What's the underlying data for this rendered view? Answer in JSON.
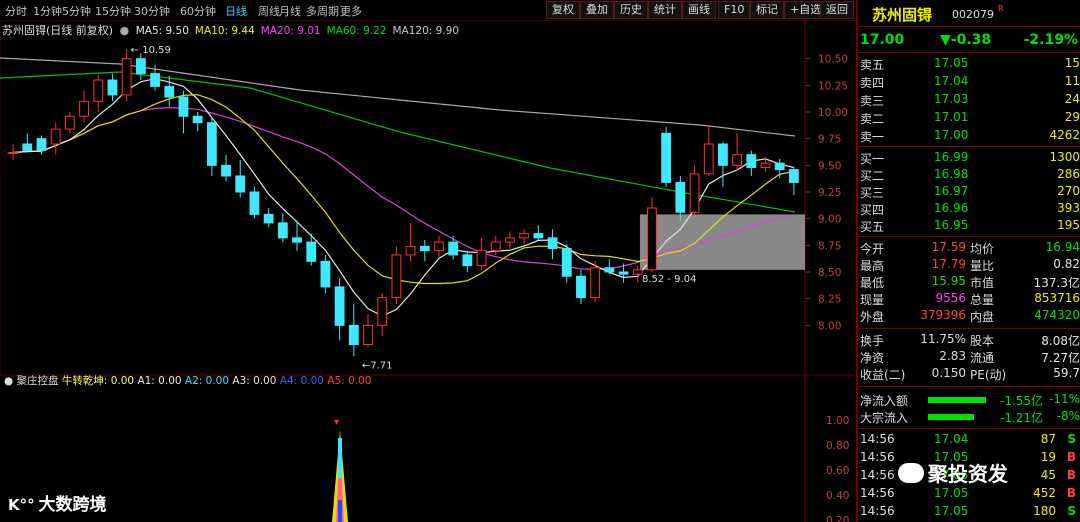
{
  "toolbar": {
    "periods": [
      "分时",
      "1分钟",
      "5分钟",
      "15分钟",
      "30分钟",
      "60分钟",
      "日线",
      "周线",
      "月线",
      "多周期",
      "更多"
    ],
    "active_period": "日线",
    "right_buttons": [
      "复权",
      "叠加",
      "历史",
      "统计",
      "画线",
      "F10",
      "标记",
      "+自选",
      "返回"
    ]
  },
  "chart_header": {
    "stock_label": "苏州固锝(日线 前复权)",
    "ma_items": [
      {
        "label": "MA5: 9.50",
        "color": "#e6e6e6"
      },
      {
        "label": "MA10: 9.44",
        "color": "#f0f000"
      },
      {
        "label": "MA20: 9.01",
        "color": "#ff40ff"
      },
      {
        "label": "MA60: 9.22",
        "color": "#00e000"
      },
      {
        "label": "MA120: 9.90",
        "color": "#c8c8c8"
      }
    ]
  },
  "price_axis": [
    "10.50",
    "10.25",
    "10.00",
    "9.75",
    "9.50",
    "9.25",
    "9.00",
    "8.75",
    "8.50",
    "8.25",
    "8.00"
  ],
  "annotations": {
    "high": "10.59",
    "low": "7.71",
    "box": "8.52 - 9.04"
  },
  "indicator": {
    "name": "聚庄控盘",
    "params": [
      {
        "label": "牛转乾坤: 0.00",
        "color": "#ffff60"
      },
      {
        "label": "A1: 0.00",
        "color": "#e6e6e6"
      },
      {
        "label": "A2: 0.00",
        "color": "#40e0ff"
      },
      {
        "label": "A3: 0.00",
        "color": "#e6e6e6"
      },
      {
        "label": "A4: 0.00",
        "color": "#4060ff"
      },
      {
        "label": "A5: 0.00",
        "color": "#ff4040"
      }
    ],
    "axis": [
      "1.00",
      "0.80",
      "0.60",
      "0.40",
      "0.20"
    ]
  },
  "panel": {
    "name": "苏州固锝",
    "code": "002079",
    "price": "17.00",
    "change": "▼-0.38",
    "pct": "-2.19%",
    "asks": [
      {
        "label": "卖五",
        "price": "17.05",
        "vol": "15"
      },
      {
        "label": "卖四",
        "price": "17.04",
        "vol": "11"
      },
      {
        "label": "卖三",
        "price": "17.03",
        "vol": "24"
      },
      {
        "label": "卖二",
        "price": "17.01",
        "vol": "29"
      },
      {
        "label": "卖一",
        "price": "17.00",
        "vol": "4262"
      }
    ],
    "bids": [
      {
        "label": "买一",
        "price": "16.99",
        "vol": "1300"
      },
      {
        "label": "买二",
        "price": "16.98",
        "vol": "286"
      },
      {
        "label": "买三",
        "price": "16.97",
        "vol": "270"
      },
      {
        "label": "买四",
        "price": "16.96",
        "vol": "393"
      },
      {
        "label": "买五",
        "price": "16.95",
        "vol": "195"
      }
    ],
    "stats": [
      {
        "k1": "今开",
        "v1": "17.59",
        "k2": "均价",
        "v2": "16.94"
      },
      {
        "k1": "最高",
        "v1": "17.79",
        "k2": "量比",
        "v2": "0.82"
      },
      {
        "k1": "最低",
        "v1": "15.95",
        "k2": "市值",
        "v2": "137.3亿"
      },
      {
        "k1": "现量",
        "v1": "9556",
        "k2": "总量",
        "v2": "853716"
      },
      {
        "k1": "外盘",
        "v1": "379396",
        "k2": "内盘",
        "v2": "474320"
      }
    ],
    "fund": [
      {
        "k1": "换手",
        "v1": "11.75%",
        "k2": "股本",
        "v2": "8.08亿"
      },
      {
        "k1": "净资",
        "v1": "2.83",
        "k2": "流通",
        "v2": "7.27亿"
      },
      {
        "k1": "收益(二)",
        "v1": "0.150",
        "k2": "PE(动)",
        "v2": "59.7"
      }
    ],
    "flows": [
      {
        "label": "净流入额",
        "value": "-1.55亿",
        "pct": "-11%"
      },
      {
        "label": "大宗流入",
        "value": "-1.21亿",
        "pct": "-8%"
      }
    ],
    "ticks": [
      {
        "time": "14:56",
        "price": "17.04",
        "vol": "87",
        "dir": "S"
      },
      {
        "time": "14:56",
        "price": "17.05",
        "vol": "19",
        "dir": "B"
      },
      {
        "time": "14:56",
        "price": "17.05",
        "vol": "45",
        "dir": "B"
      },
      {
        "time": "14:56",
        "price": "17.05",
        "vol": "452",
        "dir": "B"
      },
      {
        "time": "14:56",
        "price": "17.05",
        "vol": "180",
        "dir": "S"
      }
    ]
  },
  "watermarks": {
    "left": "大数跨境",
    "right": "聚投资发"
  },
  "chart_data": {
    "type": "candlestick",
    "y_range": [
      7.6,
      10.75
    ],
    "candles": [
      [
        9.62,
        9.7,
        9.55,
        9.62
      ],
      [
        9.7,
        9.8,
        9.62,
        9.64
      ],
      [
        9.75,
        9.78,
        9.6,
        9.64
      ],
      [
        9.7,
        9.9,
        9.6,
        9.84
      ],
      [
        9.84,
        10.0,
        9.8,
        9.96
      ],
      [
        9.96,
        10.2,
        9.9,
        10.1
      ],
      [
        10.1,
        10.35,
        10.0,
        10.3
      ],
      [
        10.3,
        10.36,
        10.1,
        10.16
      ],
      [
        10.16,
        10.59,
        10.1,
        10.5
      ],
      [
        10.5,
        10.55,
        10.3,
        10.36
      ],
      [
        10.36,
        10.44,
        10.2,
        10.24
      ],
      [
        10.24,
        10.34,
        10.05,
        10.14
      ],
      [
        10.14,
        10.2,
        9.8,
        9.96
      ],
      [
        9.96,
        10.0,
        9.82,
        9.9
      ],
      [
        9.9,
        9.95,
        9.4,
        9.5
      ],
      [
        9.5,
        9.6,
        9.35,
        9.4
      ],
      [
        9.4,
        9.55,
        9.2,
        9.25
      ],
      [
        9.25,
        9.3,
        9.0,
        9.04
      ],
      [
        9.04,
        9.1,
        8.92,
        8.96
      ],
      [
        8.96,
        9.05,
        8.78,
        8.82
      ],
      [
        8.82,
        8.98,
        8.7,
        8.78
      ],
      [
        8.78,
        8.86,
        8.56,
        8.6
      ],
      [
        8.6,
        8.66,
        8.3,
        8.36
      ],
      [
        8.36,
        8.44,
        7.86,
        8.0
      ],
      [
        8.0,
        8.2,
        7.71,
        7.82
      ],
      [
        7.82,
        8.1,
        7.8,
        8.0
      ],
      [
        8.0,
        8.3,
        7.9,
        8.26
      ],
      [
        8.26,
        8.74,
        8.2,
        8.66
      ],
      [
        8.66,
        8.96,
        8.6,
        8.74
      ],
      [
        8.74,
        8.8,
        8.6,
        8.7
      ],
      [
        8.7,
        8.84,
        8.64,
        8.78
      ],
      [
        8.78,
        8.84,
        8.62,
        8.66
      ],
      [
        8.66,
        8.7,
        8.5,
        8.56
      ],
      [
        8.56,
        8.82,
        8.52,
        8.7
      ],
      [
        8.7,
        8.84,
        8.66,
        8.78
      ],
      [
        8.78,
        8.88,
        8.72,
        8.82
      ],
      [
        8.82,
        8.9,
        8.76,
        8.86
      ],
      [
        8.86,
        8.94,
        8.8,
        8.82
      ],
      [
        8.82,
        8.9,
        8.62,
        8.72
      ],
      [
        8.72,
        8.76,
        8.4,
        8.46
      ],
      [
        8.46,
        8.52,
        8.2,
        8.26
      ],
      [
        8.26,
        8.6,
        8.22,
        8.54
      ],
      [
        8.54,
        8.62,
        8.48,
        8.5
      ],
      [
        8.5,
        8.58,
        8.4,
        8.48
      ],
      [
        8.48,
        8.56,
        8.4,
        8.52
      ],
      [
        8.52,
        9.2,
        8.5,
        9.1
      ],
      [
        9.8,
        9.86,
        9.3,
        9.34
      ],
      [
        9.34,
        9.4,
        8.98,
        9.06
      ],
      [
        9.06,
        9.5,
        9.04,
        9.42
      ],
      [
        9.42,
        9.88,
        9.4,
        9.7
      ],
      [
        9.7,
        9.72,
        9.3,
        9.5
      ],
      [
        9.5,
        9.8,
        9.44,
        9.6
      ],
      [
        9.6,
        9.64,
        9.4,
        9.48
      ],
      [
        9.48,
        9.58,
        9.44,
        9.52
      ],
      [
        9.52,
        9.56,
        9.38,
        9.46
      ],
      [
        9.46,
        9.48,
        9.22,
        9.34
      ]
    ]
  }
}
